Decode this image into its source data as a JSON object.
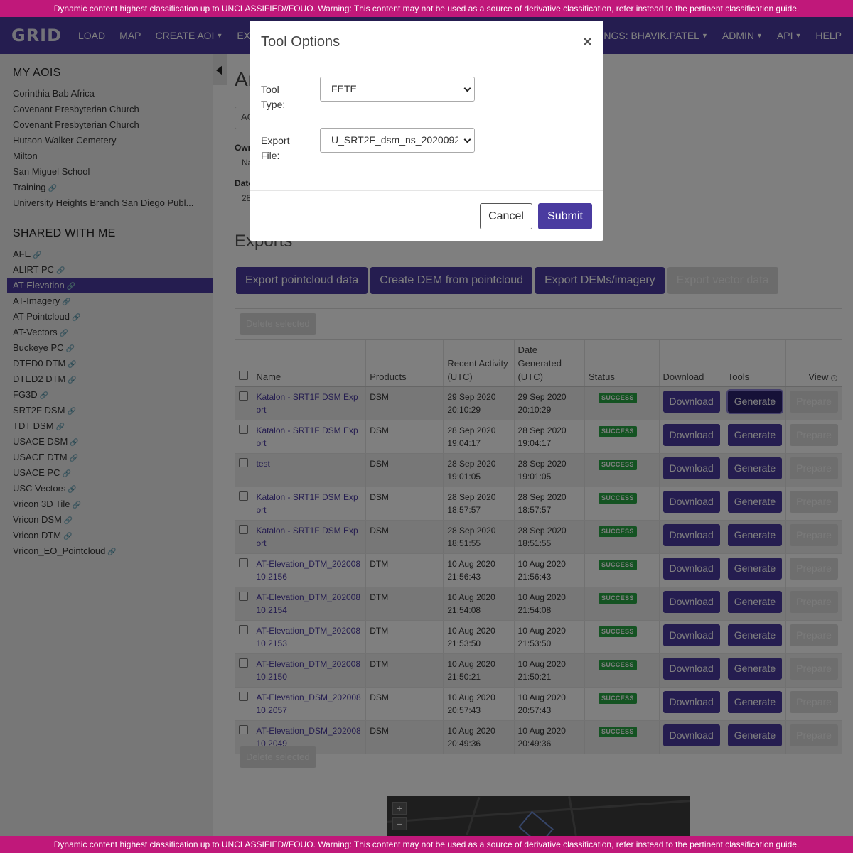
{
  "classification_banner": "Dynamic content highest classification up to UNCLASSIFIED//FOUO. Warning: This content may not be used as a source of derivative classification, refer instead to the pertinent classification guide.",
  "nav": {
    "logo": "GRID",
    "items": [
      "LOAD",
      "MAP",
      "CREATE AOI",
      "EXPORT"
    ],
    "right_items": [
      "SETTINGS: BHAVIK.PATEL",
      "ADMIN",
      "API",
      "HELP"
    ]
  },
  "sidebar": {
    "my_aois_heading": "MY AOIS",
    "my_aois": [
      "Corinthia Bab Africa",
      "Covenant Presbyterian Church",
      "Covenant Presbyterian Church",
      "Hutson-Walker Cemetery",
      "Milton",
      "San Miguel School",
      "Training",
      "University Heights Branch San Diego Publ..."
    ],
    "shared_heading": "SHARED WITH ME",
    "shared": [
      "AFE",
      "ALIRT PC",
      "AT-Elevation",
      "AT-Imagery",
      "AT-Pointcloud",
      "AT-Vectors",
      "Buckeye PC",
      "DTED0 DTM",
      "DTED2 DTM",
      "FG3D",
      "SRT2F DSM",
      "TDT DSM",
      "USACE DSM",
      "USACE DTM",
      "USACE PC",
      "USC Vectors",
      "Vricon 3D Tile",
      "Vricon DSM",
      "Vricon DTM",
      "Vricon_EO_Pointcloud"
    ],
    "active_shared": "AT-Elevation"
  },
  "main": {
    "title": "Ar",
    "aoi_select": "AO",
    "owner_label": "Own",
    "owner_value": "Na",
    "date_label": "Date",
    "date_value": "28",
    "exports_heading": "Exports",
    "action_buttons": [
      "Export pointcloud data",
      "Create DEM from pointcloud",
      "Export DEMs/imagery",
      "Export vector data"
    ],
    "delete_selected": "Delete selected",
    "columns": [
      "Name",
      "Products",
      "Recent Activity (UTC)",
      "Date Generated (UTC)",
      "Status",
      "Download",
      "Tools",
      "View"
    ],
    "rows": [
      {
        "name": "Katalon - SRT1F DSM Export",
        "product": "DSM",
        "recent": "29 Sep 2020 20:10:29",
        "generated": "29 Sep 2020 20:10:29",
        "status": "SUCCESS"
      },
      {
        "name": "Katalon - SRT1F DSM Export",
        "product": "DSM",
        "recent": "28 Sep 2020 19:04:17",
        "generated": "28 Sep 2020 19:04:17",
        "status": "SUCCESS"
      },
      {
        "name": "test",
        "product": "DSM",
        "recent": "28 Sep 2020 19:01:05",
        "generated": "28 Sep 2020 19:01:05",
        "status": "SUCCESS"
      },
      {
        "name": "Katalon - SRT1F DSM Export",
        "product": "DSM",
        "recent": "28 Sep 2020 18:57:57",
        "generated": "28 Sep 2020 18:57:57",
        "status": "SUCCESS"
      },
      {
        "name": "Katalon - SRT1F DSM Export",
        "product": "DSM",
        "recent": "28 Sep 2020 18:51:55",
        "generated": "28 Sep 2020 18:51:55",
        "status": "SUCCESS"
      },
      {
        "name": "AT-Elevation_DTM_20200810.2156",
        "product": "DTM",
        "recent": "10 Aug 2020 21:56:43",
        "generated": "10 Aug 2020 21:56:43",
        "status": "SUCCESS"
      },
      {
        "name": "AT-Elevation_DTM_20200810.2154",
        "product": "DTM",
        "recent": "10 Aug 2020 21:54:08",
        "generated": "10 Aug 2020 21:54:08",
        "status": "SUCCESS"
      },
      {
        "name": "AT-Elevation_DTM_20200810.2153",
        "product": "DTM",
        "recent": "10 Aug 2020 21:53:50",
        "generated": "10 Aug 2020 21:53:50",
        "status": "SUCCESS"
      },
      {
        "name": "AT-Elevation_DTM_20200810.2150",
        "product": "DTM",
        "recent": "10 Aug 2020 21:50:21",
        "generated": "10 Aug 2020 21:50:21",
        "status": "SUCCESS"
      },
      {
        "name": "AT-Elevation_DSM_20200810.2057",
        "product": "DSM",
        "recent": "10 Aug 2020 20:57:43",
        "generated": "10 Aug 2020 20:57:43",
        "status": "SUCCESS"
      },
      {
        "name": "AT-Elevation_DSM_20200810.2049",
        "product": "DSM",
        "recent": "10 Aug 2020 20:49:36",
        "generated": "10 Aug 2020 20:49:36",
        "status": "SUCCESS"
      }
    ],
    "download_label": "Download",
    "generate_label": "Generate",
    "prepare_label": "Prepare",
    "map_zoom_in": "+",
    "map_zoom_out": "−"
  },
  "modal": {
    "title": "Tool Options",
    "close": "×",
    "tool_type_label": "Tool Type:",
    "tool_type_value": "FETE",
    "export_file_label": "Export File:",
    "export_file_value": "U_SRT2F_dsm_ns_2020092",
    "cancel": "Cancel",
    "submit": "Submit"
  },
  "colors": {
    "brand_purple": "#4a3ba0",
    "classification_magenta": "#c0187a",
    "success_green": "#28a745"
  },
  "icons": {
    "link": "link-icon",
    "help": "help-icon",
    "collapse": "caret-left-icon"
  }
}
